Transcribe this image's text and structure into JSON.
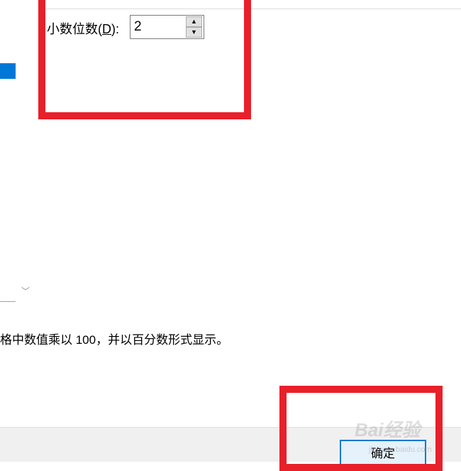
{
  "decimal_places": {
    "label": "小数位数(",
    "accel": "D",
    "label_end": "):",
    "value": "2",
    "up_glyph": "▲",
    "down_glyph": "▼"
  },
  "category_list": {
    "scroll_down_glyph": "﹀"
  },
  "description": "格中数值乘以 100，并以百分数形式显示。",
  "buttons": {
    "ok_label": "确定"
  },
  "watermark": {
    "text": "Bai经验",
    "url": "jingyan.baidu.com"
  },
  "colors": {
    "highlight": "#e8202a",
    "selection": "#0078d7",
    "accent": "#0078d7"
  }
}
